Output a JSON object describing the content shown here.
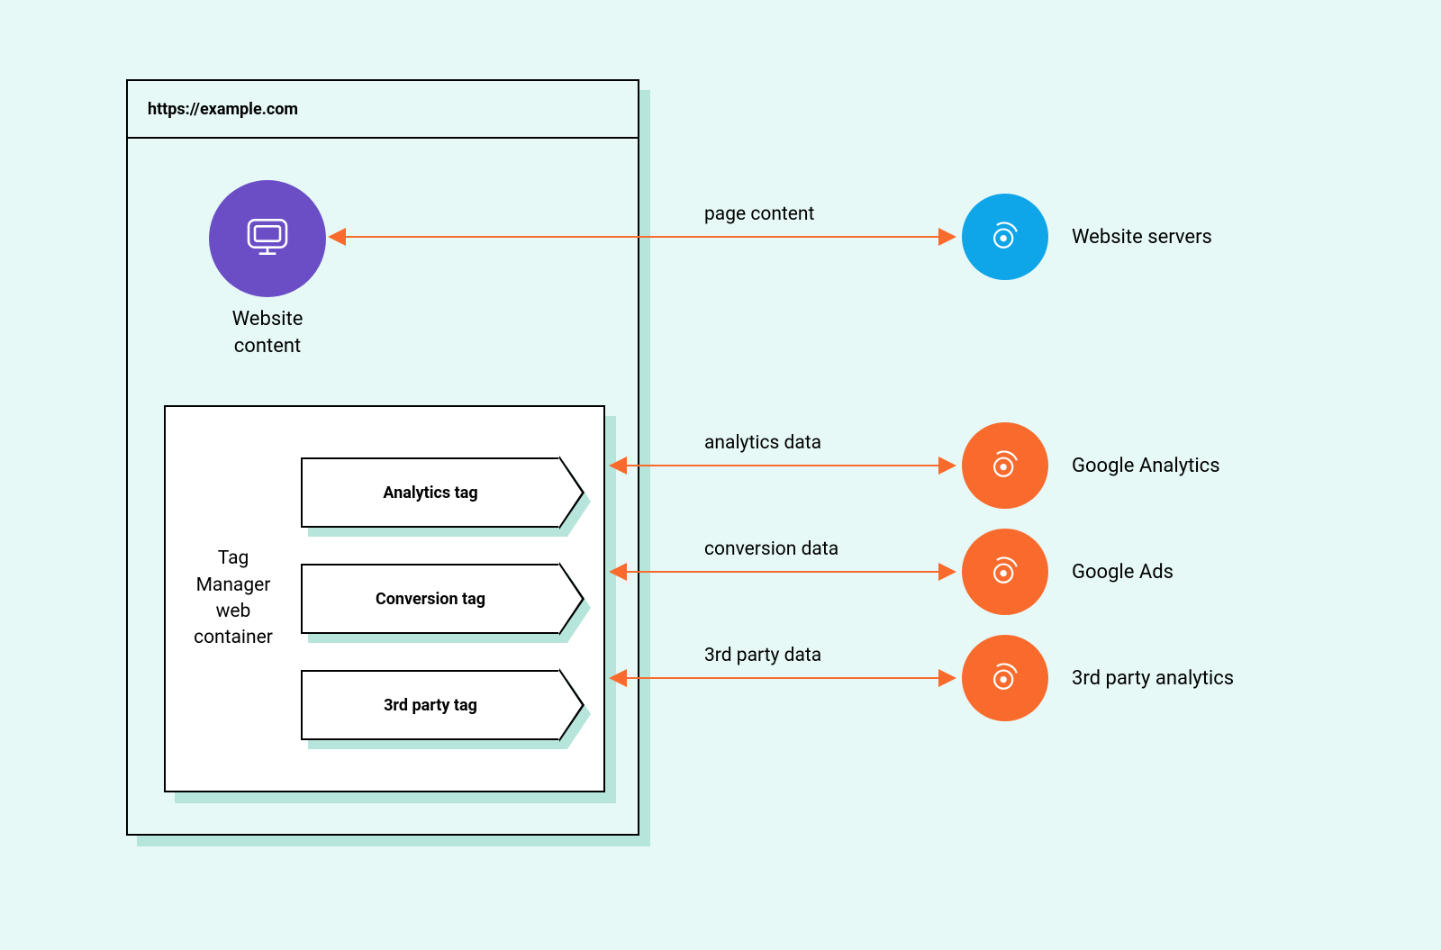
{
  "browser": {
    "url": "https://example.com"
  },
  "site": {
    "label": "Website content",
    "icon": "monitor-icon"
  },
  "tag_manager": {
    "label": "Tag Manager web container",
    "tags": [
      {
        "label": "Analytics tag"
      },
      {
        "label": "Conversion tag"
      },
      {
        "label": "3rd party tag"
      }
    ]
  },
  "connectors": [
    {
      "label": "page content"
    },
    {
      "label": "analytics data"
    },
    {
      "label": "conversion data"
    },
    {
      "label": "3rd party data"
    }
  ],
  "endpoints": [
    {
      "label": "Website servers",
      "color": "blue",
      "icon": "server-glyph-icon"
    },
    {
      "label": "Google Analytics",
      "color": "orange",
      "icon": "server-glyph-icon"
    },
    {
      "label": "Google Ads",
      "color": "orange",
      "icon": "server-glyph-icon"
    },
    {
      "label": "3rd party analytics",
      "color": "orange",
      "icon": "server-glyph-icon"
    }
  ],
  "colors": {
    "background": "#e6f9f7",
    "shadow": "#b6e5db",
    "site_circle": "#6b4ec6",
    "endpoint_blue": "#0ea5e9",
    "endpoint_orange": "#f96b2d",
    "arrow": "#f96b2d"
  }
}
